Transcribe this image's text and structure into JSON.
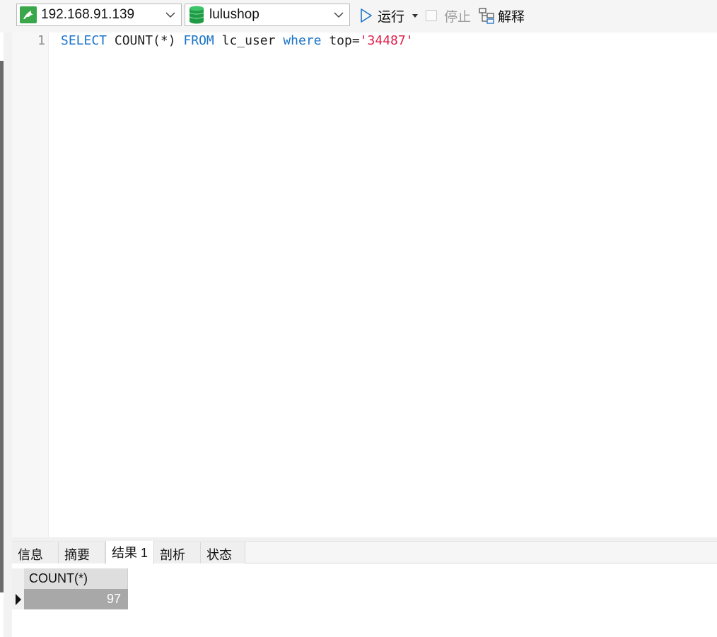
{
  "toolbar": {
    "connection": {
      "value": "192.168.91.139",
      "icon": "dolphin-icon"
    },
    "database": {
      "value": "lulushop",
      "icon": "database-icon"
    },
    "run_label": "运行",
    "stop_label": "停止",
    "explain_label": "解释"
  },
  "editor": {
    "line_number": "1",
    "tokens": [
      {
        "text": "SELECT",
        "type": "keyword"
      },
      {
        "text": " COUNT(*) ",
        "type": "plain"
      },
      {
        "text": "FROM",
        "type": "keyword"
      },
      {
        "text": " lc_user ",
        "type": "plain"
      },
      {
        "text": "where",
        "type": "keyword"
      },
      {
        "text": " top=",
        "type": "plain"
      },
      {
        "text": "'34487'",
        "type": "string"
      }
    ]
  },
  "result_tabs": [
    {
      "label": "信息",
      "active": false
    },
    {
      "label": "摘要",
      "active": false
    },
    {
      "label": "结果 1",
      "active": true
    },
    {
      "label": "剖析",
      "active": false
    },
    {
      "label": "状态",
      "active": false
    }
  ],
  "result_grid": {
    "columns": [
      "COUNT(*)"
    ],
    "rows": [
      [
        "97"
      ]
    ]
  },
  "colors": {
    "keyword": "#1a73c8",
    "string": "#e01e4a",
    "selected_cell": "#a8a8a8",
    "connection_icon": "#3aa84a"
  }
}
